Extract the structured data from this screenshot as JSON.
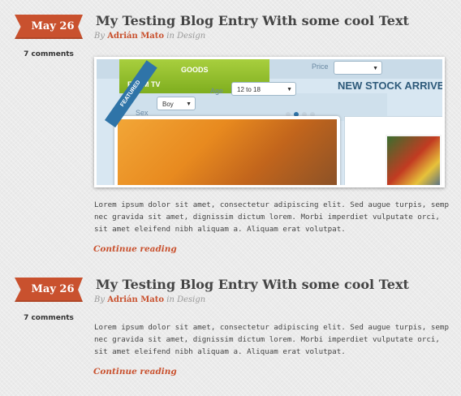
{
  "posts": [
    {
      "date": "May 26",
      "comments": "7 comments",
      "title": "My Testing Blog Entry With some cool Text",
      "by": "By",
      "author": "Adrián Mato",
      "in": "in",
      "category": "Design",
      "excerpt_lines": [
        "Lorem ipsum dolor sit amet, consectetur adipiscing elit. Sed augue turpis, semp",
        "nec gravida sit amet, dignissim dictum lorem.  Morbi imperdiet vulputate orci,",
        "sit amet eleifend nibh aliquam a. Aliquam erat volutpat."
      ],
      "more": "Continue reading",
      "image": {
        "nav": [
          "FROM TV",
          "GOODS"
        ],
        "price_label": "Price",
        "sex_label": "Sex",
        "sex_value": "Boy",
        "age_label": "Age",
        "age_value": "12 to 18",
        "banner": "NEW STOCK ARRIVE",
        "badge": "FEATURED",
        "carousel_active": 2,
        "carousel_count": 4
      }
    },
    {
      "date": "May 26",
      "comments": "7 comments",
      "title": "My Testing Blog Entry With some cool Text",
      "by": "By",
      "author": "Adrián Mato",
      "in": "in",
      "category": "Design",
      "excerpt_lines": [
        "Lorem ipsum dolor sit amet, consectetur adipiscing elit. Sed augue turpis, semp",
        "nec gravida sit amet, dignissim dictum lorem.  Morbi imperdiet vulputate orci,",
        "sit amet eleifend nibh aliquam a. Aliquam erat volutpat."
      ],
      "more": "Continue reading"
    }
  ],
  "colors": {
    "accent": "#c9512e",
    "background": "#ebebeb",
    "title": "#444444"
  }
}
